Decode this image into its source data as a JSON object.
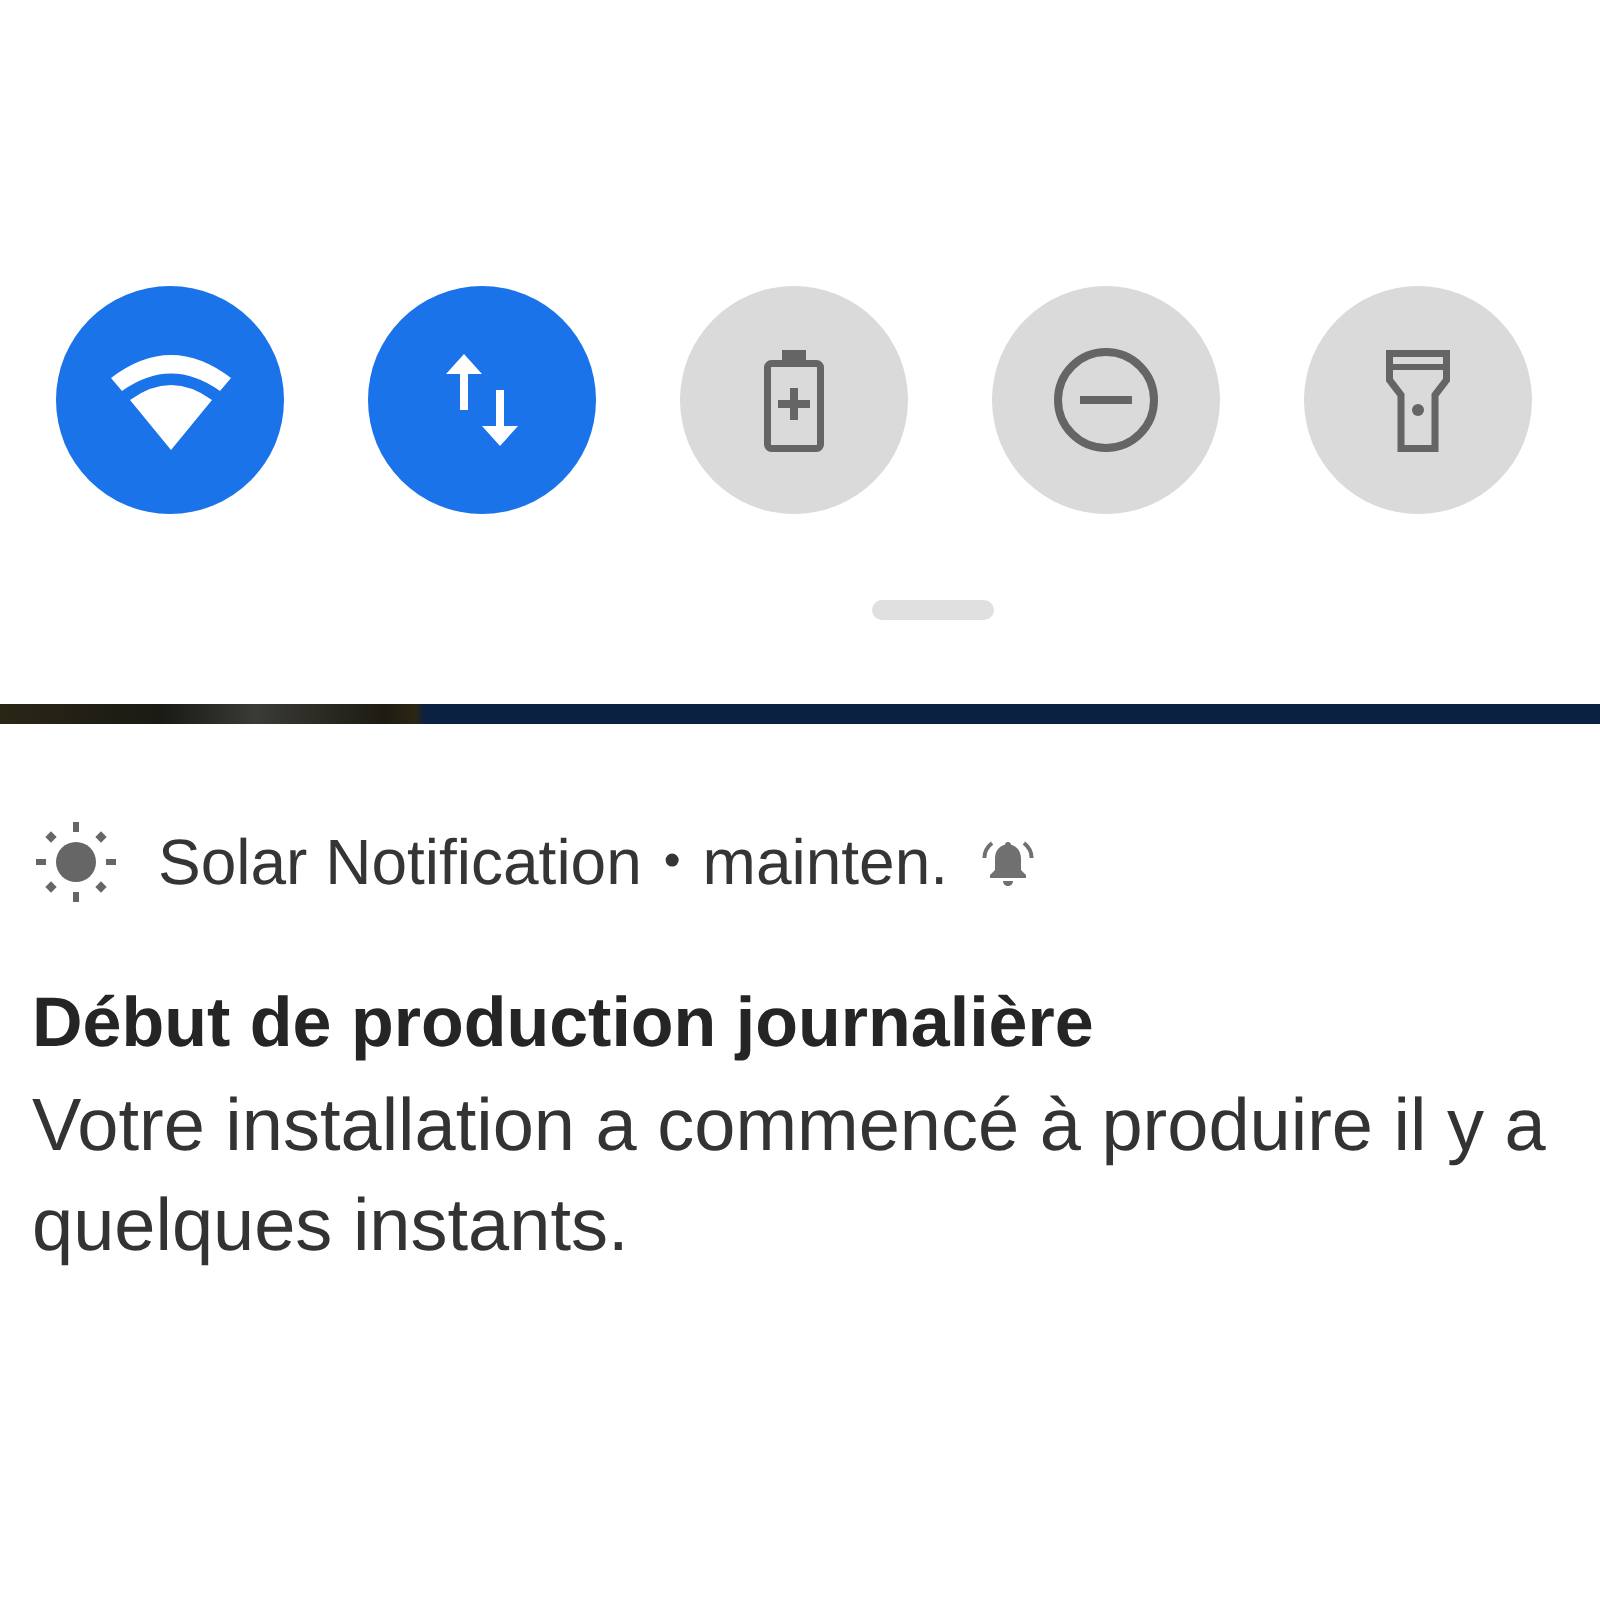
{
  "quick_settings": {
    "tiles": [
      {
        "kind": "wifi",
        "on": true
      },
      {
        "kind": "mobile_data",
        "on": true
      },
      {
        "kind": "battery_saver",
        "on": false
      },
      {
        "kind": "do_not_disturb",
        "on": false
      },
      {
        "kind": "flashlight",
        "on": false
      }
    ]
  },
  "notification": {
    "app_name": "Solar Notification",
    "separator": "•",
    "channel": "mainten.",
    "title": "Début de production journalière",
    "body": "Votre installation a commencé à produire il y a quelques instants."
  }
}
